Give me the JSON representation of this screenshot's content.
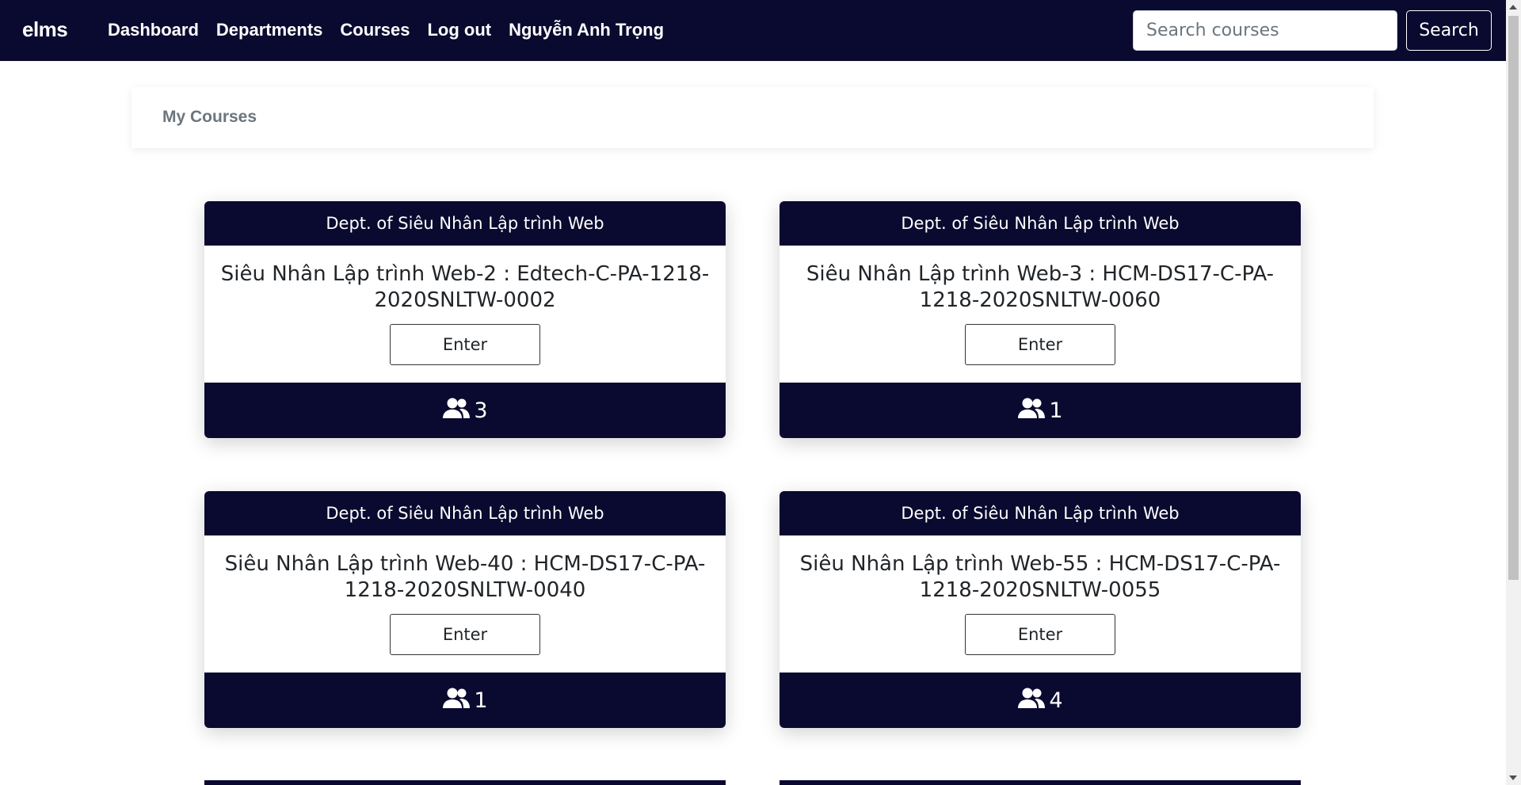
{
  "navbar": {
    "brand": "elms",
    "links": [
      "Dashboard",
      "Departments",
      "Courses",
      "Log out",
      "Nguyễn Anh Trọng"
    ],
    "search_placeholder": "Search courses",
    "search_button": "Search"
  },
  "breadcrumb": {
    "title": "My Courses"
  },
  "courses": [
    {
      "department": "Dept. of Siêu Nhân Lập trình Web",
      "title": "Siêu Nhân Lập trình Web-2 : Edtech-C-PA-1218-2020SNLTW-0002",
      "enter_label": "Enter",
      "members": "3"
    },
    {
      "department": "Dept. of Siêu Nhân Lập trình Web",
      "title": "Siêu Nhân Lập trình Web-3 : HCM-DS17-C-PA-1218-2020SNLTW-0060",
      "enter_label": "Enter",
      "members": "1"
    },
    {
      "department": "Dept. of Siêu Nhân Lập trình Web",
      "title": "Siêu Nhân Lập trình Web-40 : HCM-DS17-C-PA-1218-2020SNLTW-0040",
      "enter_label": "Enter",
      "members": "1"
    },
    {
      "department": "Dept. of Siêu Nhân Lập trình Web",
      "title": "Siêu Nhân Lập trình Web-55 : HCM-DS17-C-PA-1218-2020SNLTW-0055",
      "enter_label": "Enter",
      "members": "4"
    }
  ],
  "colors": {
    "navy": "#0a0a30",
    "muted": "#6c757d"
  },
  "icons": {
    "members": "users-icon"
  }
}
